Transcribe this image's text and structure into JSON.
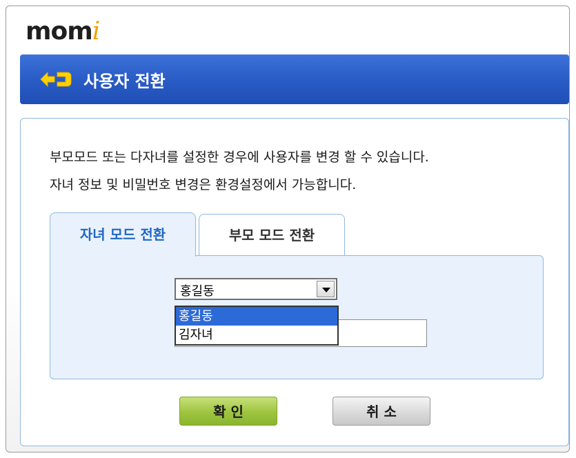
{
  "app": {
    "logo_text": "mom",
    "logo_accent": "i"
  },
  "title": {
    "text": "사용자 전환",
    "icon": "switch-arrows-icon"
  },
  "description": {
    "line1": "부모모드 또는 다자녀를 설정한 경우에 사용자를 변경 할 수 있습니다.",
    "line2": "자녀 정보 및 비밀번호 변경은 환경설정에서 가능합니다."
  },
  "tabs": [
    {
      "label": "자녀 모드 전환",
      "active": true
    },
    {
      "label": "부모 모드 전환",
      "active": false
    }
  ],
  "user_select": {
    "selected": "홍길동",
    "options": [
      "홍길동",
      "김자녀"
    ],
    "open": true,
    "highlighted_index": 0
  },
  "password_field": {
    "value": ""
  },
  "buttons": {
    "ok_label": "확 인",
    "cancel_label": "취 소"
  },
  "colors": {
    "title_bar": "#2a5cc6",
    "accent_blue": "#1f66c4",
    "tab_bg": "#e9f2fc",
    "ok_green": "#9fc43f",
    "logo_orange": "#f2a200"
  }
}
